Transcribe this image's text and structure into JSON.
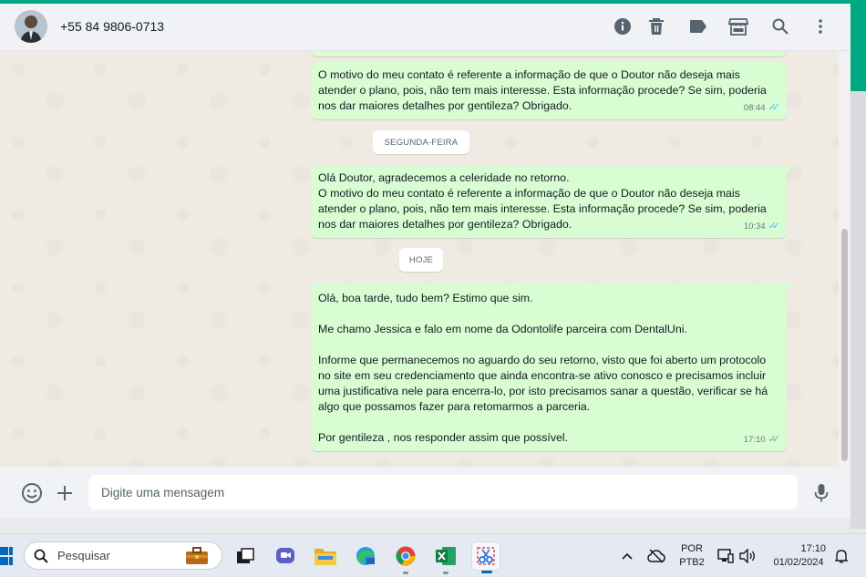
{
  "header": {
    "contact_name": "+55 84 9806-0713"
  },
  "messages": [
    {
      "text": "O motivo do meu contato é referente a informação de que o Doutor não deseja mais atender o plano, pois, não tem mais interesse. Esta informação procede? Se sim, poderia nos dar maiores detalhes por gentileza? Obrigado.",
      "time": "08:44"
    },
    {
      "text": "Olá Doutor, agradecemos a celeridade no retorno.\nO motivo do meu contato é referente a informação de que o Doutor não deseja mais atender o plano, pois, não tem mais interesse. Esta informação procede? Se sim, poderia nos dar maiores detalhes por gentileza? Obrigado.",
      "time": "10:34"
    },
    {
      "text": "Olá, boa tarde, tudo bem? Estimo que sim.\n\nMe chamo Jessica e falo em nome da Odontolife parceira com DentalUni.\n\nInforme que permanecemos no aguardo do seu retorno, visto que foi aberto um protocolo no site em seu credenciamento que ainda encontra-se ativo conosco e precisamos incluir uma justificativa nele para encerra-lo, por isto precisamos sanar a questão, verificar se há algo que possamos fazer para retomarmos a parceria.\n\nPor gentileza , nos responder assim que possível.",
      "time": "17:10"
    }
  ],
  "date_chips": {
    "monday": "SEGUNDA-FEIRA",
    "today": "HOJE"
  },
  "composer": {
    "placeholder": "Digite uma mensagem"
  },
  "taskbar": {
    "search_placeholder": "Pesquisar",
    "language_line1": "POR",
    "language_line2": "PTB2",
    "time": "17:10",
    "date": "01/02/2024"
  },
  "colors": {
    "accent": "#00a884",
    "outgoing_bubble": "#d9fdd3",
    "read_ticks": "#53bdeb",
    "chat_background": "#efeae2"
  }
}
